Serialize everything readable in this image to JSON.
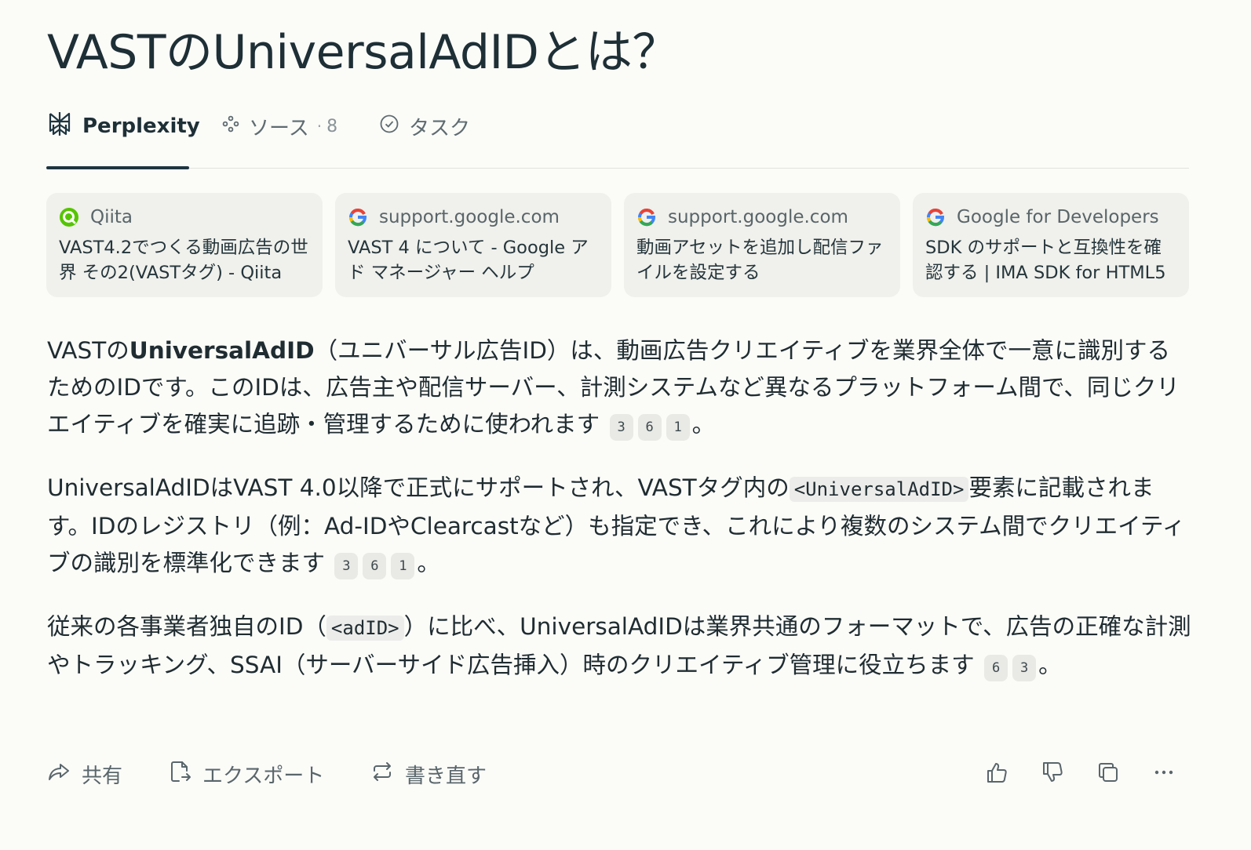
{
  "title": "VASTのUniversalAdIDとは？",
  "tabs": {
    "perplexity": "Perplexity",
    "sources": "ソース",
    "sources_sep": "·",
    "sources_count": "8",
    "tasks": "タスク"
  },
  "cards": [
    {
      "source": "Qiita",
      "icon": "qiita-icon",
      "title": "VAST4.2でつくる動画広告の世界 その2(VASTタグ) - Qiita"
    },
    {
      "source": "support.google.com",
      "icon": "google-icon",
      "title": "VAST 4 について - Google アド マネージャー ヘルプ"
    },
    {
      "source": "support.google.com",
      "icon": "google-icon",
      "title": "動画アセットを追加し配信ファイルを設定する"
    },
    {
      "source": "Google for Developers",
      "icon": "google-icon",
      "title": "SDK のサポートと互換性を確認する | IMA SDK for HTML5"
    }
  ],
  "answer": {
    "p1": {
      "a": "VASTの",
      "b": "UniversalAdID",
      "c": "（ユニバーサル広告ID）は、動画広告クリエイティブを業界全体で一意に識別するためのIDです。このIDは、広告主や配信サーバー、計測システムなど異なるプラットフォーム間で、同じクリエイティブを確実に追跡・管理するために使われます",
      "cites": [
        "3",
        "6",
        "1"
      ],
      "end": "。"
    },
    "p2": {
      "a": "UniversalAdIDはVAST 4.0以降で正式にサポートされ、VASTタグ内の",
      "code": "<UniversalAdID>",
      "c": "要素に記載されます。IDのレジストリ（例：Ad-IDやClearcastなど）も指定でき、これにより複数のシステム間でクリエイティブの識別を標準化できます",
      "cites": [
        "3",
        "6",
        "1"
      ],
      "end": "。"
    },
    "p3": {
      "a": "従来の各事業者独自のID（",
      "code": "<adID>",
      "c": "）に比べ、UniversalAdIDは業界共通のフォーマットで、広告の正確な計測やトラッキング、SSAI（サーバーサイド広告挿入）時のクリエイティブ管理に役立ちます",
      "cites": [
        "6",
        "3"
      ],
      "end": "。"
    }
  },
  "actions": {
    "share": "共有",
    "export": "エクスポート",
    "rewrite": "書き直す"
  }
}
